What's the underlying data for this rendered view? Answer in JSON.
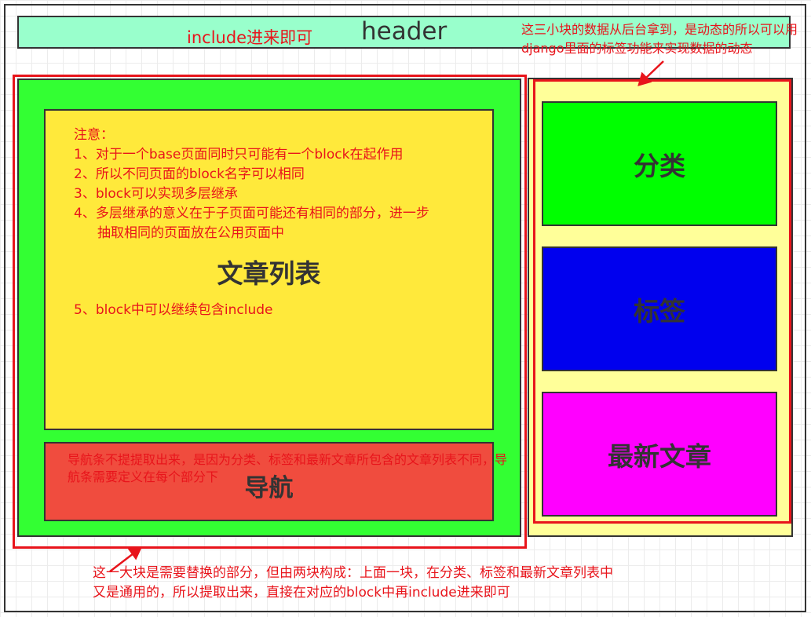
{
  "header": {
    "title": "header",
    "include_note": "include进来即可"
  },
  "dynamic_note": "这三小块的数据从后台拿到，是动态的所以可以用django里面的标签功能来实现数据的动态",
  "article_list": {
    "title": "文章列表",
    "notes": [
      "注意：",
      "1、对于一个base页面同时只可能有一个block在起作用",
      "2、所以不同页面的block名字可以相同",
      "3、block可以实现多层继承",
      "4、多层继承的意义在于子页面可能还有相同的部分，进一步",
      "抽取相同的页面放在公用页面中"
    ],
    "note_5": "5、block中可以继续包含include"
  },
  "nav": {
    "title": "导航",
    "note": "导航条不提提取出来，是因为分类、标签和最新文章所包含的文章列表不同，导航条需要定义在每个部分下"
  },
  "side_boxes": {
    "category": "分类",
    "tags": "标签",
    "latest": "最新文章"
  },
  "bottom_note": [
    "这一大块是需要替换的部分，但由两块构成：上面一块，在分类、标签和最新文章列表中",
    "又是通用的，所以提取出来，直接在对应的block中再include进来即可"
  ],
  "colors": {
    "header_fill": "#99ffcc",
    "green_block": "#33ff33",
    "article_fill": "#ffe93b",
    "nav_fill": "#f04c3e",
    "side_panel": "#ffff99",
    "category_fill": "#00ff00",
    "tags_fill": "#0000ee",
    "latest_fill": "#ff00ff",
    "annotation": "#e8141b"
  }
}
